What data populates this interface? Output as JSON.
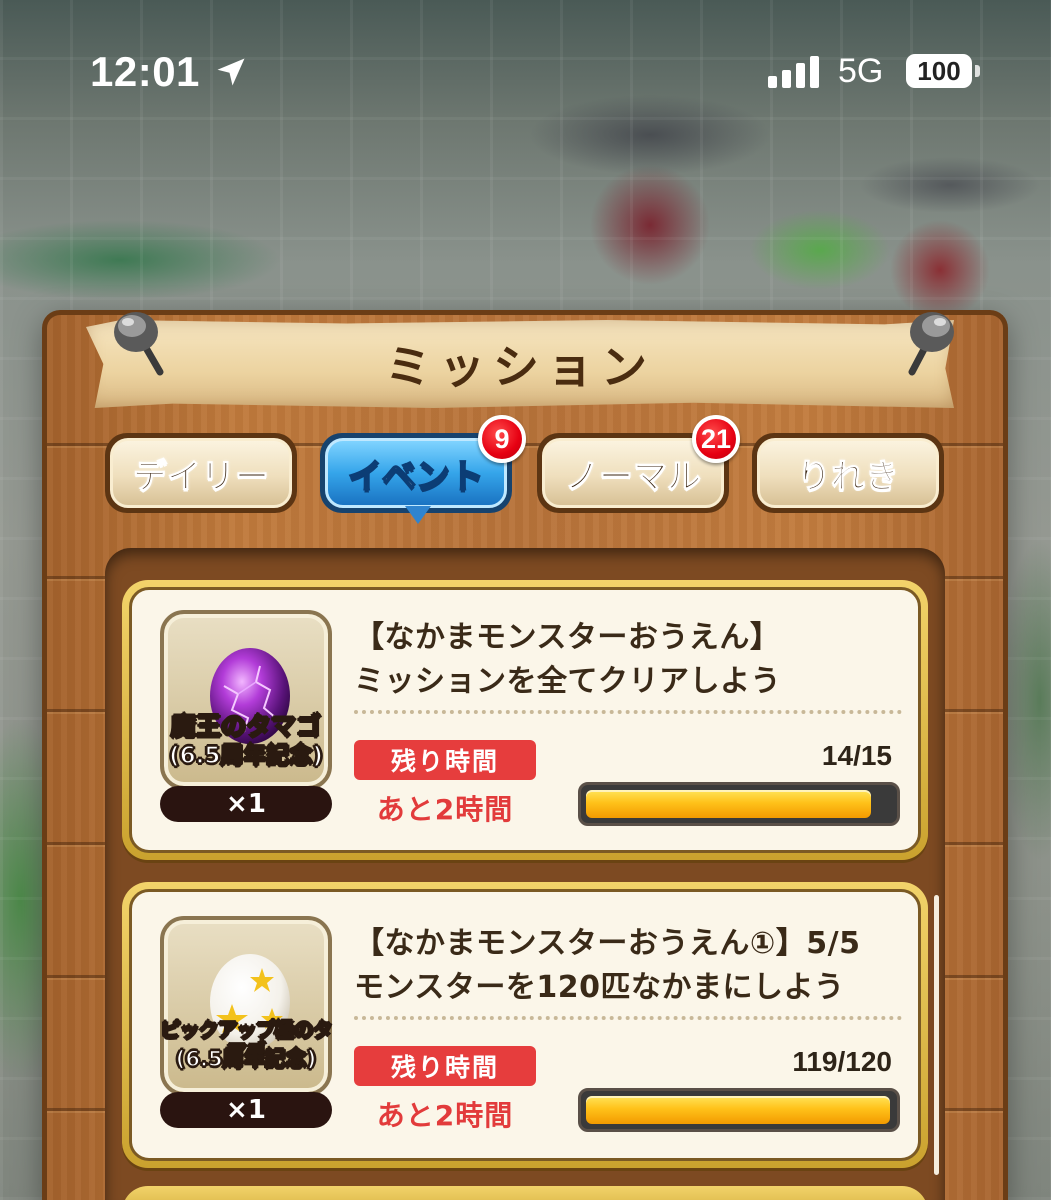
{
  "status_bar": {
    "time": "12:01",
    "network": "5G",
    "battery": "100"
  },
  "header": {
    "title": "ミッション"
  },
  "tabs": [
    {
      "label": "デイリー",
      "active": false,
      "badge": ""
    },
    {
      "label": "イベント",
      "active": true,
      "badge": "9"
    },
    {
      "label": "ノーマル",
      "active": false,
      "badge": "21"
    },
    {
      "label": "りれき",
      "active": false,
      "badge": ""
    }
  ],
  "missions": [
    {
      "title_line1": "【なかまモンスターおうえん】",
      "title_line2": "ミッションを全てクリアしよう",
      "reward_name_line1": "魔王のタマゴ",
      "reward_name_line2": "(6.5周年記念)",
      "reward_qty": "×1",
      "reward_icon": "purple-egg-icon",
      "time_label": "残り時間",
      "time_left": "あと2時間",
      "progress_text": "14/15",
      "progress_fraction": 0.933
    },
    {
      "title_line1": "【なかまモンスターおうえん①】5/5",
      "title_line2": "モンスターを120匹なかまにしよう",
      "reward_name_line1": "ピックアップ極のタマゴ",
      "reward_name_line2": "(6.5周年記念)",
      "reward_qty": "×1",
      "reward_icon": "star-egg-icon",
      "time_label": "残り時間",
      "time_left": "あと2時間",
      "progress_text": "119/120",
      "progress_fraction": 0.992
    }
  ],
  "colors": {
    "active_tab": "#35a5ea",
    "badge": "#e60012",
    "time_label_bg": "#e63d3d",
    "progress_fill": "#ffc21a"
  }
}
